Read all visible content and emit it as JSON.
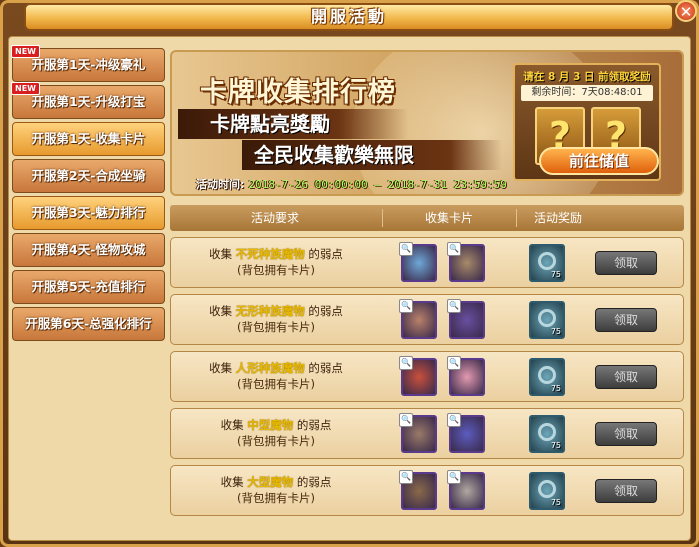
{
  "window": {
    "title": "開服活動",
    "close_label": "✕"
  },
  "nav": [
    {
      "label": "开服第1天-冲级豪礼",
      "badge": "NEW",
      "active": false
    },
    {
      "label": "开服第1天-升级打宝",
      "badge": "NEW",
      "active": false
    },
    {
      "label": "开服第1天-收集卡片",
      "badge": "",
      "active": true
    },
    {
      "label": "开服第2天-合成坐骑",
      "badge": "",
      "active": false
    },
    {
      "label": "开服第3天-魅力排行",
      "badge": "",
      "active": true
    },
    {
      "label": "开服第4天-怪物攻城",
      "badge": "",
      "active": false
    },
    {
      "label": "开服第5天-充值排行",
      "badge": "",
      "active": false
    },
    {
      "label": "开服第6天-总强化排行",
      "badge": "",
      "active": false
    }
  ],
  "banner": {
    "title": "卡牌收集排行榜",
    "line2": "卡牌點亮獎勵",
    "line3": "全民收集歡樂無限",
    "time_label": "活动时间:",
    "time_range": "2018-7-26 00:00:00 — 2018-7-31 23:59:59",
    "count_line1": "请在 8 月 3 日 前领取奖励",
    "count_line2": "剩余时间：7天08:48:01",
    "qmark": "?",
    "go_button": "前往储值"
  },
  "table": {
    "headers": [
      "活动要求",
      "收集卡片",
      "活动奖励"
    ],
    "claim_label": "领取",
    "reward_count": "75",
    "zoom_glyph": "🔍",
    "rows": [
      {
        "prefix": "收集",
        "monster": "不死种族魔物",
        "suffix": "的弱点",
        "note": "(背包拥有卡片)",
        "card_colors": [
          "#6fa8d8",
          "#a88a6a"
        ]
      },
      {
        "prefix": "收集",
        "monster": "无形种族魔物",
        "suffix": "的弱点",
        "note": "(背包拥有卡片)",
        "card_colors": [
          "#b9826a",
          "#6a4fa0"
        ]
      },
      {
        "prefix": "收集",
        "monster": "人形种族魔物",
        "suffix": "的弱点",
        "note": "(背包拥有卡片)",
        "card_colors": [
          "#c9503c",
          "#e39ab0"
        ]
      },
      {
        "prefix": "收集",
        "monster": "中型魔物",
        "suffix": "的弱点",
        "note": "(背包拥有卡片)",
        "card_colors": [
          "#9a7a68",
          "#5c5cc0"
        ]
      },
      {
        "prefix": "收集",
        "monster": "大型魔物",
        "suffix": "的弱点",
        "note": "(背包拥有卡片)",
        "card_colors": [
          "#8a6a4a",
          "#b0a8a0"
        ]
      }
    ]
  }
}
